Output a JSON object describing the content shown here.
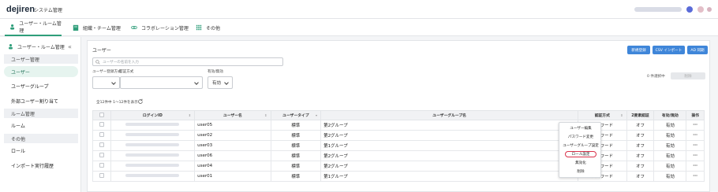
{
  "header": {
    "logo": "dejiren",
    "app_title": "システム管理",
    "nav_tabs": [
      {
        "label": "ユーザー・ルーム管理",
        "icon": "person-icon",
        "active": true
      },
      {
        "label": "組織・チーム管理",
        "icon": "building-icon",
        "active": false
      },
      {
        "label": "コラボレーション管理",
        "icon": "link-icon",
        "active": false
      },
      {
        "label": "その他",
        "icon": "grid-icon",
        "active": false
      }
    ]
  },
  "sidebar": {
    "title": "ユーザー・ルーム管理",
    "collapse_label": "«",
    "sections": {
      "user_mgmt": "ユーザー管理",
      "room_mgmt": "ルーム管理",
      "other": "その他"
    },
    "items": {
      "user": "ユーザー",
      "user_group": "ユーザーグループ",
      "external_assign": "外部ユーザー割り当て",
      "room": "ルーム",
      "role": "ロール",
      "import_history": "インポート実行履歴"
    }
  },
  "main": {
    "title": "ユーザー",
    "buttons": {
      "new_register": "新規登録",
      "csv_import": "CSV インポート",
      "ad_sync": "AD 同期"
    },
    "search_placeholder": "ユーザーの名前を入力",
    "filters": {
      "register_method_label": "ユーザー登録方式",
      "auth_method_label": "認証方式",
      "enabled_label": "有効/無効",
      "enabled_value": "有効"
    },
    "selected_count": "0 件選択中",
    "delete_label": "削除",
    "result_count": "全12件中 1〜12件を表示",
    "table": {
      "headers": [
        "ログインID",
        "ユーザー名",
        "ユーザータイプ",
        "ユーザーグループ名",
        "認証方式",
        "2要素認証",
        "有効/無効",
        "操作"
      ],
      "rows": [
        {
          "user": "user05",
          "type": "標準",
          "group": "第2グループ",
          "auth": "パスワード",
          "twofa": "オフ",
          "status": "有効"
        },
        {
          "user": "user02",
          "type": "標準",
          "group": "第2グループ",
          "auth": "パスワード",
          "twofa": "オフ",
          "status": "有効"
        },
        {
          "user": "user03",
          "type": "標準",
          "group": "第1グループ",
          "auth": "パスワード",
          "twofa": "オフ",
          "status": "有効"
        },
        {
          "user": "user06",
          "type": "標準",
          "group": "第2グループ",
          "auth": "パスワード",
          "twofa": "オフ",
          "status": "有効"
        },
        {
          "user": "user04",
          "type": "標準",
          "group": "第2グループ",
          "auth": "パスワード",
          "twofa": "オフ",
          "status": "有効"
        },
        {
          "user": "user01",
          "type": "標準",
          "group": "第1グループ",
          "auth": "パスワード",
          "twofa": "オフ",
          "status": "有効"
        }
      ],
      "actions_label": "⋯"
    },
    "context_menu": [
      "ユーザー編集",
      "パスワード変更",
      "ユーザーグループ設定",
      "ロール設定",
      "無効化",
      "削除"
    ]
  },
  "colors": {
    "accent": "#2f9e7a",
    "primary_button": "#3f86d9",
    "highlight": "#d9324a"
  }
}
